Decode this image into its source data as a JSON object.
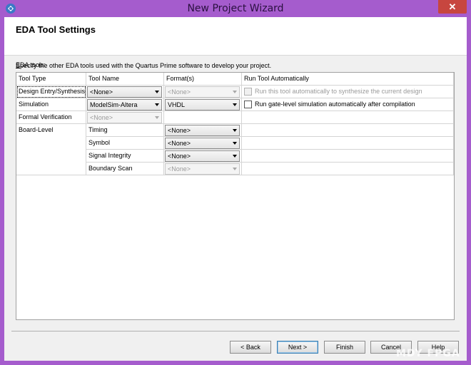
{
  "window": {
    "title": "New Project Wizard",
    "close_label": "✕"
  },
  "page": {
    "title": "EDA Tool Settings",
    "description": "Specify the other EDA tools used with the Quartus Prime software to develop your project.",
    "eda_tools_label": "EDA tools:"
  },
  "table": {
    "headers": [
      "Tool Type",
      "Tool Name",
      "Format(s)",
      "Run Tool Automatically"
    ],
    "rows": [
      {
        "type": "Design Entry/Synthesis",
        "tool": "<None>",
        "tool_enabled": true,
        "format": "<None>",
        "format_enabled": false,
        "run_label": "Run this tool automatically to synthesize the current design",
        "run_enabled": false
      },
      {
        "type": "Simulation",
        "tool": "ModelSim-Altera",
        "tool_enabled": true,
        "format": "VHDL",
        "format_enabled": true,
        "run_label": "Run gate-level simulation automatically after compilation",
        "run_enabled": true
      },
      {
        "type": "Formal Verification",
        "tool": "<None>",
        "tool_enabled": false
      },
      {
        "type": "Board-Level",
        "tool": "Timing",
        "format": "<None>",
        "format_enabled": true
      },
      {
        "type": "",
        "tool": "Symbol",
        "format": "<None>",
        "format_enabled": true
      },
      {
        "type": "",
        "tool": "Signal Integrity",
        "format": "<None>",
        "format_enabled": true
      },
      {
        "type": "",
        "tool": "Boundary Scan",
        "format": "<None>",
        "format_enabled": false
      }
    ]
  },
  "buttons": {
    "back": "< Back",
    "next": "Next >",
    "finish": "Finish",
    "cancel": "Cancel",
    "help": "Help"
  },
  "watermark": "MDY FPGA"
}
